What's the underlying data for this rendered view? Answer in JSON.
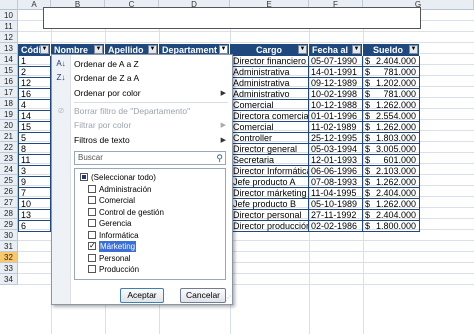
{
  "column_headers": [
    "A",
    "B",
    "C",
    "D",
    "E",
    "F",
    "G"
  ],
  "row_numbers": [
    "10",
    "11",
    "12",
    "13",
    "14",
    "15",
    "16",
    "17",
    "18",
    "19",
    "20",
    "21",
    "22",
    "23",
    "24",
    "25",
    "26",
    "27",
    "28",
    "29",
    "30",
    "31",
    "32",
    "33",
    "34"
  ],
  "selected_row": "32",
  "table": {
    "headers": [
      "Códi",
      "Nombre",
      "Apellido",
      "Departament",
      "Cargo",
      "Fecha al",
      "Sueldo"
    ],
    "codes": [
      "1",
      "2",
      "12",
      "16",
      "4",
      "14",
      "15",
      "5",
      "8",
      "11",
      "3",
      "9",
      "7",
      "10",
      "13",
      "6"
    ],
    "cargos": [
      "Director financiero",
      "Administrativa",
      "Administrativa",
      "Administrativo",
      "Comercial",
      "Directora comercial",
      "Comercial",
      "Controller",
      "Director general",
      "Secretaria",
      "Director Informática",
      "Jefe producto A",
      "Director márketing",
      "Jefe producto B",
      "Director personal",
      "Director producción"
    ],
    "fechas": [
      "05-07-1990",
      "14-01-1991",
      "09-12-1989",
      "10-02-1998",
      "10-12-1988",
      "01-01-1996",
      "11-02-1989",
      "25-12-1995",
      "05-03-1994",
      "12-01-1993",
      "06-06-1996",
      "07-08-1993",
      "11-04-1995",
      "05-10-1989",
      "27-11-1992",
      "02-02-1986"
    ],
    "currency": "$",
    "sueldos": [
      "2.404.000",
      "781.000",
      "1.202.000",
      "781.000",
      "1.262.000",
      "2.554.000",
      "1.262.000",
      "1.803.000",
      "3.005.000",
      "601.000",
      "2.103.000",
      "1.262.000",
      "2.404.000",
      "1.262.000",
      "2.404.000",
      "1.800.000"
    ]
  },
  "filter_menu": {
    "sort_asc": "Ordenar de A a Z",
    "sort_desc": "Ordenar de Z a A",
    "sort_color": "Ordenar por color",
    "clear_filter": "Borrar filtro de \"Departamento\"",
    "filter_color": "Filtrar por color",
    "text_filters": "Filtros de texto",
    "search_placeholder": "Buscar",
    "items": [
      {
        "label": "(Seleccionar todo)",
        "state": "partial"
      },
      {
        "label": "Administración",
        "state": "unchecked"
      },
      {
        "label": "Comercial",
        "state": "unchecked"
      },
      {
        "label": "Control de gestión",
        "state": "unchecked"
      },
      {
        "label": "Gerencia",
        "state": "unchecked"
      },
      {
        "label": "Informática",
        "state": "unchecked"
      },
      {
        "label": "Márketing",
        "state": "checked"
      },
      {
        "label": "Personal",
        "state": "unchecked"
      },
      {
        "label": "Producción",
        "state": "unchecked"
      }
    ],
    "ok_label": "Aceptar",
    "cancel_label": "Cancelar"
  }
}
